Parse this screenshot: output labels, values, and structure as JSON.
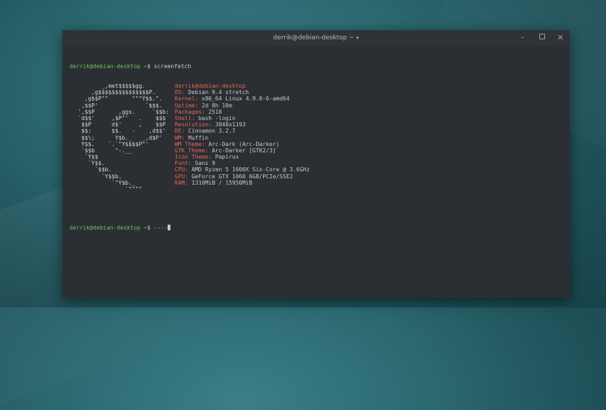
{
  "window": {
    "title": "derrik@debian-desktop ~",
    "menu_arrow": "▾",
    "minimize": "–",
    "close": "✕"
  },
  "terminal": {
    "prompt1": {
      "user_host": "derrik@debian-desktop",
      "path_symbol": " ~$ ",
      "command": "screenfetch"
    },
    "header": "derrik@debian-desktop",
    "logo_lines": [
      "       _,met$$$$$gg.",
      "    ,g$$$$$$$$$$$$$$$P.",
      "  ,g$$P\"\"       \"\"\"Y$$.\".",
      " ,$$P'              `$$$.",
      "',$$P       ,ggs.     `$$b:",
      "`d$$'     ,$P\"'   .    $$$",
      " $$P      d$'     ,    $$P",
      " $$:      $$.   -    ,d$$'",
      " $$\\;      Y$b._   _,d$P'",
      " Y$$.    `.`\"Y$$$$P\"'",
      " `$$b      \"-.__",
      "  `Y$$",
      "   `Y$$.",
      "     `$$b.",
      "       `Y$$b.",
      "          `\"Y$b._",
      "              `\"\"\"\""
    ],
    "info": [
      {
        "key": "OS:",
        "value": "Debian 9.4 stretch"
      },
      {
        "key": "Kernel:",
        "value": "x86_64 Linux 4.9.0-6-amd64"
      },
      {
        "key": "Uptime:",
        "value": "2d 8h 10m"
      },
      {
        "key": "Packages:",
        "value": "2518"
      },
      {
        "key": "Shell:",
        "value": "bash -login"
      },
      {
        "key": "Resolution:",
        "value": "3840x1193"
      },
      {
        "key": "DE:",
        "value": "Cinnamon 3.2.7"
      },
      {
        "key": "WM:",
        "value": "Muffin"
      },
      {
        "key": "WM Theme:",
        "value": "Arc-Dark (Arc-Darker)"
      },
      {
        "key": "GTK Theme:",
        "value": "Arc-Darker [GTK2/3]"
      },
      {
        "key": "Icon Theme:",
        "value": "Papirus"
      },
      {
        "key": "Font:",
        "value": "Sans 9"
      },
      {
        "key": "CPU:",
        "value": "AMD Ryzen 5 1600X Six-Core @ 3.6GHz"
      },
      {
        "key": "GPU:",
        "value": "GeForce GTX 1060 6GB/PCIe/SSE2"
      },
      {
        "key": "RAM:",
        "value": "1310MiB / 15950MiB"
      }
    ],
    "prompt2": {
      "user_host": "derrik@debian-desktop",
      "path_symbol": " ~$ ",
      "command": "----"
    }
  },
  "colors": {
    "prompt_user": "#6cc45a",
    "info_key": "#e06a55",
    "terminal_bg": "#2b2e33"
  }
}
